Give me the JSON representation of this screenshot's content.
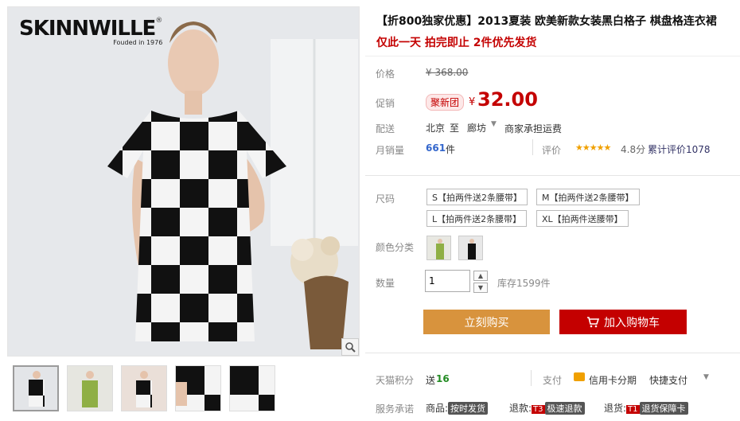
{
  "brand": {
    "name": "SKINNWILLE",
    "mark": "®",
    "tagline": "Fouded in 1976"
  },
  "product": {
    "title": "【折800独家优惠】2013夏装 欧美新款女装黑白格子 棋盘格连衣裙",
    "subtitle": "仅此一天 拍完即止 2件优先发货"
  },
  "price": {
    "label": "价格",
    "original": "¥ 368.00",
    "promo_label": "促销",
    "promo_tag": "聚新团",
    "currency": "¥",
    "current": "32.00"
  },
  "shipping": {
    "label": "配送",
    "from": "北京",
    "to_word": "至",
    "to_city": "廊坊",
    "note": "商家承担运费"
  },
  "sales": {
    "label": "月销量",
    "count": "661",
    "unit": "件",
    "rating_label": "评价",
    "stars": "★★★★★",
    "score": "4.8分",
    "total_reviews": "累计评价1078"
  },
  "sizes": {
    "label": "尺码",
    "options": [
      "S【拍两件送2条腰带】",
      "M【拍两件送2条腰带】",
      "L【拍两件送2条腰带】",
      "XL【拍两件送腰带】"
    ]
  },
  "colors": {
    "label": "颜色分类"
  },
  "quantity": {
    "label": "数量",
    "value": "1",
    "up": "▲",
    "down": "▼",
    "stock": "库存1599件"
  },
  "actions": {
    "buy_now": "立刻购买",
    "add_cart": "加入购物车"
  },
  "points": {
    "label": "天猫积分",
    "prefix": "送",
    "value": "16",
    "pay_label": "支付",
    "credit": "信用卡分期",
    "quick_pay": "快捷支付"
  },
  "service": {
    "label": "服务承诺",
    "goods": "商品:",
    "goods_tag": "按时发货",
    "refund": "退款:",
    "refund_badge": "T3",
    "refund_tag": "极速退款",
    "return": "退货:",
    "return_badge": "T1",
    "return_tag": "退货保障卡"
  },
  "colors_palette": {
    "accent_red": "#c40000",
    "buy_orange": "#d8933d"
  }
}
